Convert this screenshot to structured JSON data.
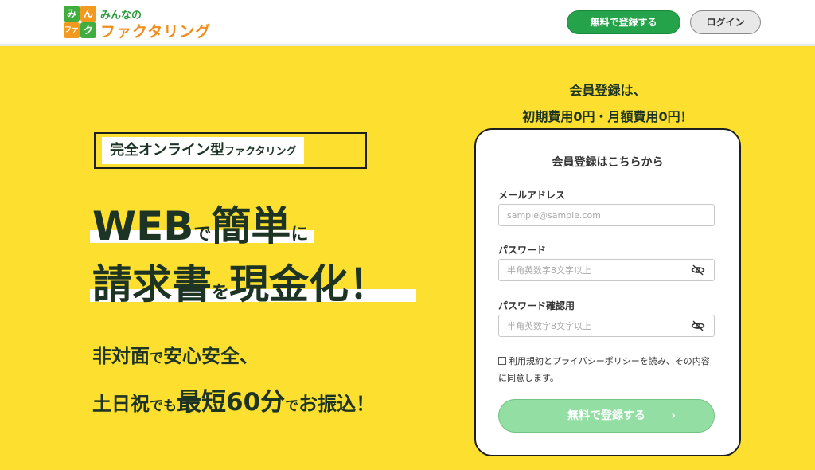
{
  "header": {
    "logo_tiles": [
      "み",
      "ん",
      "ファ",
      "ク"
    ],
    "logo_top": "みんなの",
    "logo_main": "ファクタリング",
    "signup_button": "無料で登録する",
    "login_button": "ログイン"
  },
  "hero": {
    "badge_main": "完全オンライン型",
    "badge_sub": "ファクタリング",
    "line1": {
      "a": "WEB",
      "b": "で",
      "c": "簡単",
      "d": "に"
    },
    "line2": {
      "a": "請求書",
      "b": "を",
      "c": "現金化！"
    },
    "sub1": {
      "a": "非対面",
      "b": "で",
      "c": "安心安全、"
    },
    "sub2": {
      "a": "土日祝",
      "b": "でも",
      "c": "最短60分",
      "d": "で",
      "e": "お振込！"
    }
  },
  "signup": {
    "headline1": "会員登録は、",
    "headline2": "初期費用0円・月額費用0円！",
    "card_title": "会員登録はこちらから",
    "email_label": "メールアドレス",
    "email_placeholder": "sample@sample.com",
    "password_label": "パスワード",
    "password_placeholder": "半角英数字8文字以上",
    "password_confirm_label": "パスワード確認用",
    "password_confirm_placeholder": "半角英数字8文字以上",
    "agree_text": "利用規約とプライバシーポリシーを読み、その内容に同意します。",
    "submit_label": "無料で登録する",
    "submit_chevron": "›"
  },
  "colors": {
    "background": "#fde02f",
    "primary_green": "#25a34a",
    "submit_disabled": "#93dfa3",
    "logo_orange": "#f08d1b",
    "text_dark": "#1d3424"
  },
  "icons": {
    "password_toggle": "eye-slash-icon"
  }
}
